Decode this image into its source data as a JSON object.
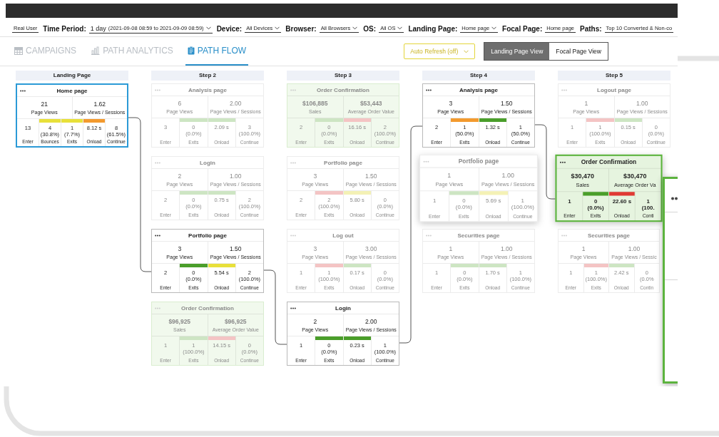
{
  "mode": "Real User",
  "filters": [
    {
      "label": "Time Period:",
      "value": "1 day",
      "detail": "(2021-09-08 08:59 to 2021-09-09 08:59)",
      "dropdown": true
    },
    {
      "label": "Device:",
      "value": "All Devices",
      "dropdown": true
    },
    {
      "label": "Browser:",
      "value": "All Browsers",
      "dropdown": true
    },
    {
      "label": "OS:",
      "value": "All OS",
      "dropdown": true
    },
    {
      "label": "Landing Page:",
      "value": "Home page",
      "dropdown": true
    },
    {
      "label": "Focal Page:",
      "value": "Home page",
      "dropdown": false
    },
    {
      "label": "Paths:",
      "value": "Top 10 Converted & Non-co",
      "dropdown": false
    }
  ],
  "tabs": [
    {
      "label": "CAMPAIGNS",
      "selected": false
    },
    {
      "label": "PATH ANALYTICS",
      "selected": false
    },
    {
      "label": "PATH FLOW",
      "selected": true
    }
  ],
  "auto_refresh": {
    "label": "Auto Refresh (off)"
  },
  "view_toggle": [
    {
      "label": "Landing Page View",
      "selected": true
    },
    {
      "label": "Focal Page View",
      "selected": false
    }
  ],
  "columns": [
    {
      "title": "Landing Page",
      "cards": [
        {
          "title": "Home page",
          "kind": "page",
          "dimmed": false,
          "selected": true,
          "raised": false,
          "metrics": [
            {
              "value": "21",
              "label": "Page Views"
            },
            {
              "value": "1.62",
              "label": "Page Views / Sessions"
            }
          ],
          "stats": [
            {
              "value": "13",
              "label": "Enter"
            },
            {
              "value": "4",
              "percent": "(30.8%)",
              "label": "Bounces",
              "color": "#e8e03a"
            },
            {
              "value": "1",
              "percent": "(7.7%)",
              "label": "Exits",
              "color": "#e8e03a"
            },
            {
              "value": "8.12 s",
              "label": "Onload",
              "color": "#f39a2e"
            },
            {
              "value": "8",
              "percent": "(61.5%)",
              "label": "Continue"
            }
          ]
        }
      ]
    },
    {
      "title": "Step 2",
      "cards": [
        {
          "title": "Analysis page",
          "kind": "page",
          "dimmed": true,
          "selected": false,
          "raised": false,
          "metrics": [
            {
              "value": "6",
              "label": "Page Views"
            },
            {
              "value": "2.00",
              "label": "Page Views / Sessions"
            }
          ],
          "stats": [
            {
              "value": "3",
              "label": "Enter"
            },
            {
              "value": "0",
              "percent": "(0.0%)",
              "label": "Exits",
              "color": "#cde5c3"
            },
            {
              "value": "2.09 s",
              "label": "Onload",
              "color": "#cde5c3"
            },
            {
              "value": "3",
              "percent": "(100.0%)",
              "label": "Continue"
            }
          ]
        },
        {
          "title": "Login",
          "kind": "page",
          "dimmed": true,
          "selected": false,
          "raised": false,
          "metrics": [
            {
              "value": "2",
              "label": "Page Views"
            },
            {
              "value": "1.00",
              "label": "Page Views / Sessions"
            }
          ],
          "stats": [
            {
              "value": "2",
              "label": "Enter"
            },
            {
              "value": "0",
              "percent": "(0.0%)",
              "label": "Exits",
              "color": "#cde5c3"
            },
            {
              "value": "0.75 s",
              "label": "Onload",
              "color": "#cde5c3"
            },
            {
              "value": "2",
              "percent": "(100.0%)",
              "label": "Continue"
            }
          ]
        },
        {
          "title": "Portfolio page",
          "kind": "page",
          "dimmed": false,
          "selected": false,
          "raised": false,
          "metrics": [
            {
              "value": "3",
              "label": "Page Views"
            },
            {
              "value": "1.50",
              "label": "Page Views / Sessions"
            }
          ],
          "stats": [
            {
              "value": "2",
              "label": "Enter"
            },
            {
              "value": "0",
              "percent": "(0.0%)",
              "label": "Exits",
              "color": "#4a9e2a"
            },
            {
              "value": "5.54 s",
              "label": "Onload",
              "color": "#e8e03a"
            },
            {
              "value": "2",
              "percent": "(100.0%)",
              "label": "Continue"
            }
          ]
        },
        {
          "title": "Order Confirmation",
          "kind": "order",
          "dimmed": true,
          "selected": false,
          "raised": false,
          "metrics": [
            {
              "value": "$96,925",
              "label": "Sales"
            },
            {
              "value": "$96,925",
              "label": "Average Order Value"
            }
          ],
          "stats": [
            {
              "value": "1",
              "label": "Enter"
            },
            {
              "value": "1",
              "percent": "(100.0%)",
              "label": "Exits",
              "color": "#cde5c3"
            },
            {
              "value": "14.15 s",
              "label": "Onload",
              "color": "#f4c4c4"
            },
            {
              "value": "0",
              "percent": "(0.0%)",
              "label": "Continue"
            }
          ]
        }
      ]
    },
    {
      "title": "Step 3",
      "cards": [
        {
          "title": "Order Confirmation",
          "kind": "order",
          "dimmed": true,
          "selected": false,
          "raised": false,
          "metrics": [
            {
              "value": "$106,885",
              "label": "Sales"
            },
            {
              "value": "$53,443",
              "label": "Average Order Value"
            }
          ],
          "stats": [
            {
              "value": "2",
              "label": "Enter"
            },
            {
              "value": "0",
              "percent": "(0.0%)",
              "label": "Exits",
              "color": "#cde5c3"
            },
            {
              "value": "16.16 s",
              "label": "Onload",
              "color": "#f4c4c4"
            },
            {
              "value": "2",
              "percent": "(100.0%)",
              "label": "Continue"
            }
          ]
        },
        {
          "title": "Portfolio page",
          "kind": "page",
          "dimmed": true,
          "selected": false,
          "raised": false,
          "metrics": [
            {
              "value": "3",
              "label": "Page Views"
            },
            {
              "value": "1.50",
              "label": "Page Views / Sessions"
            }
          ],
          "stats": [
            {
              "value": "2",
              "label": "Enter"
            },
            {
              "value": "2",
              "percent": "(100.0%)",
              "label": "Exits",
              "color": "#f4c4c4"
            },
            {
              "value": "5.80 s",
              "label": "Onload",
              "color": "#f4f1b5"
            },
            {
              "value": "0",
              "percent": "(0.0%)",
              "label": "Continue"
            }
          ]
        },
        {
          "title": "Log out",
          "kind": "page",
          "dimmed": true,
          "selected": false,
          "raised": false,
          "metrics": [
            {
              "value": "3",
              "label": "Page Views"
            },
            {
              "value": "3.00",
              "label": "Page Views / Sessions"
            }
          ],
          "stats": [
            {
              "value": "1",
              "label": "Enter"
            },
            {
              "value": "1",
              "percent": "(100.0%)",
              "label": "Exits",
              "color": "#f4c4c4"
            },
            {
              "value": "0.17 s",
              "label": "Onload",
              "color": "#cde5c3"
            },
            {
              "value": "0",
              "percent": "(0.0%)",
              "label": "Continue"
            }
          ]
        },
        {
          "title": "Login",
          "kind": "page",
          "dimmed": false,
          "selected": false,
          "raised": false,
          "metrics": [
            {
              "value": "2",
              "label": "Page Views"
            },
            {
              "value": "2.00",
              "label": "Page Views / Sessions"
            }
          ],
          "stats": [
            {
              "value": "1",
              "label": "Enter"
            },
            {
              "value": "0",
              "percent": "(0.0%)",
              "label": "Exits",
              "color": "#4a9e2a"
            },
            {
              "value": "0.23 s",
              "label": "Onload",
              "color": "#4a9e2a"
            },
            {
              "value": "1",
              "percent": "(100.0%)",
              "label": "Continue"
            }
          ]
        }
      ]
    },
    {
      "title": "Step 4",
      "cards": [
        {
          "title": "Analysis page",
          "kind": "page",
          "dimmed": false,
          "selected": false,
          "raised": false,
          "metrics": [
            {
              "value": "3",
              "label": "Page Views"
            },
            {
              "value": "1.50",
              "label": "Page Views / Sessions"
            }
          ],
          "stats": [
            {
              "value": "2",
              "label": "Enter"
            },
            {
              "value": "1",
              "percent": "(50.0%)",
              "label": "Exits",
              "color": "#f39a2e"
            },
            {
              "value": "1.32 s",
              "label": "Onload",
              "color": "#4a9e2a"
            },
            {
              "value": "1",
              "percent": "(50.0%)",
              "label": "Continue"
            }
          ]
        },
        {
          "title": "Portfolio page",
          "kind": "page",
          "dimmed": true,
          "selected": false,
          "raised": true,
          "metrics": [
            {
              "value": "1",
              "label": "Page Views"
            },
            {
              "value": "1.00",
              "label": "Page Views / Sessions"
            }
          ],
          "stats": [
            {
              "value": "1",
              "label": "Enter"
            },
            {
              "value": "0",
              "percent": "(0.0%)",
              "label": "Exits",
              "color": "#cde5c3"
            },
            {
              "value": "5.69 s",
              "label": "Onload",
              "color": "#f4f1b5"
            },
            {
              "value": "1",
              "percent": "(100.0%)",
              "label": "Continue"
            }
          ]
        },
        {
          "title": "Securities page",
          "kind": "page",
          "dimmed": true,
          "selected": false,
          "raised": false,
          "metrics": [
            {
              "value": "1",
              "label": "Page Views"
            },
            {
              "value": "1.00",
              "label": "Page Views / Sessions"
            }
          ],
          "stats": [
            {
              "value": "1",
              "label": "Enter"
            },
            {
              "value": "0",
              "percent": "(0.0%)",
              "label": "Exits",
              "color": "#cde5c3"
            },
            {
              "value": "1.70 s",
              "label": "Onload",
              "color": "#cde5c3"
            },
            {
              "value": "1",
              "percent": "(100.0%)",
              "label": "Continue"
            }
          ]
        }
      ]
    },
    {
      "title": "Step 5",
      "cards": [
        {
          "title": "Logout page",
          "kind": "page",
          "dimmed": true,
          "selected": false,
          "raised": false,
          "metrics": [
            {
              "value": "1",
              "label": "Page Views"
            },
            {
              "value": "1.00",
              "label": "Page Views / Sessions"
            }
          ],
          "stats": [
            {
              "value": "1",
              "label": "Enter"
            },
            {
              "value": "1",
              "percent": "(100.0%)",
              "label": "Exits",
              "color": "#f4c4c4"
            },
            {
              "value": "0.15 s",
              "label": "Onload",
              "color": "#cde5c3"
            },
            {
              "value": "0",
              "percent": "(0.0%)",
              "label": "Continue"
            }
          ]
        },
        {
          "title": "Order Confirmation",
          "kind": "order",
          "dimmed": false,
          "selected": false,
          "raised": true,
          "metrics": [
            {
              "value": "$30,470",
              "label": "Sales"
            },
            {
              "value": "$30,470",
              "label": "Average Order Va"
            }
          ],
          "stats": [
            {
              "value": "1",
              "label": "Enter"
            },
            {
              "value": "0",
              "percent": "(0.0%)",
              "label": "Exits",
              "color": "#4a9e2a"
            },
            {
              "value": "22.60 s",
              "label": "Onload",
              "color": "#e03a33"
            },
            {
              "value": "1",
              "percent": "(100.",
              "label": "Conti"
            }
          ]
        },
        {
          "title": "Securities page",
          "kind": "page",
          "dimmed": true,
          "selected": false,
          "raised": false,
          "metrics": [
            {
              "value": "1",
              "label": "Page Views"
            },
            {
              "value": "1.00",
              "label": "Page Views / Sessic"
            }
          ],
          "stats": [
            {
              "value": "1",
              "label": "Enter"
            },
            {
              "value": "1",
              "percent": "(100.0%)",
              "label": "Exits",
              "color": "#f4c4c4"
            },
            {
              "value": "2.42 s",
              "label": "Onload",
              "color": "#cde5c3"
            },
            {
              "value": "0",
              "percent": "(0.0%",
              "label": "Contin"
            }
          ]
        }
      ]
    }
  ]
}
